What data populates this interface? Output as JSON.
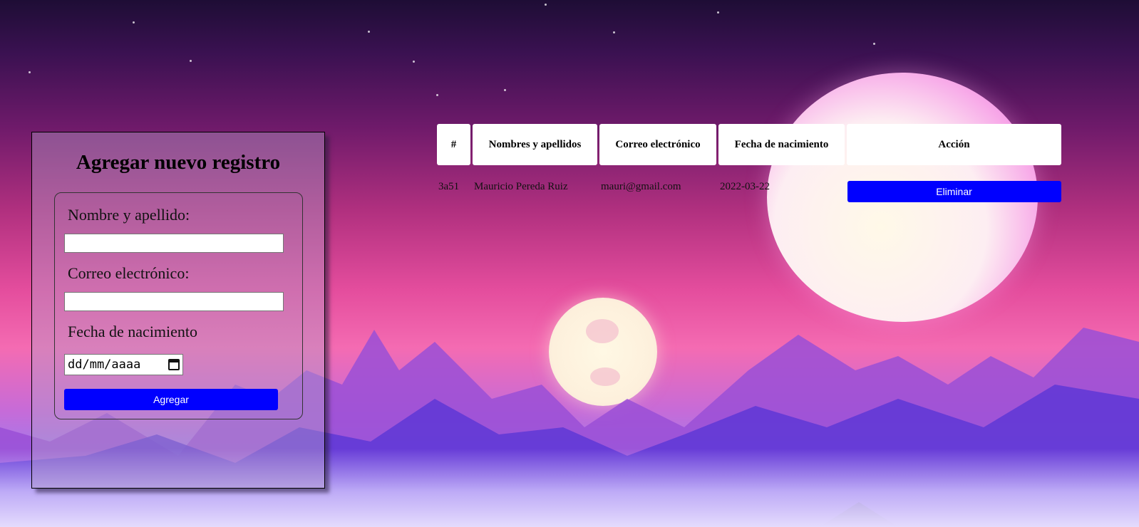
{
  "form": {
    "title": "Agregar nuevo registro",
    "name_label": "Nombre y apellido:",
    "name_value": "",
    "email_label": "Correo electrónico:",
    "email_value": "",
    "birth_label": "Fecha de nacimiento",
    "birth_placeholder": "dd/mm/aaaa",
    "add_button": "Agregar"
  },
  "table": {
    "headers": [
      "#",
      "Nombres y apellidos",
      "Correo electrónico",
      "Fecha de nacimiento",
      "Acción"
    ],
    "rows": [
      {
        "id": "3a51",
        "name": "Mauricio Pereda Ruiz",
        "email": "mauri@gmail.com",
        "birth_date": "2022-03-22",
        "action": "Eliminar"
      }
    ]
  },
  "colors": {
    "button": "#0000ff",
    "button_text": "#ffffff"
  }
}
